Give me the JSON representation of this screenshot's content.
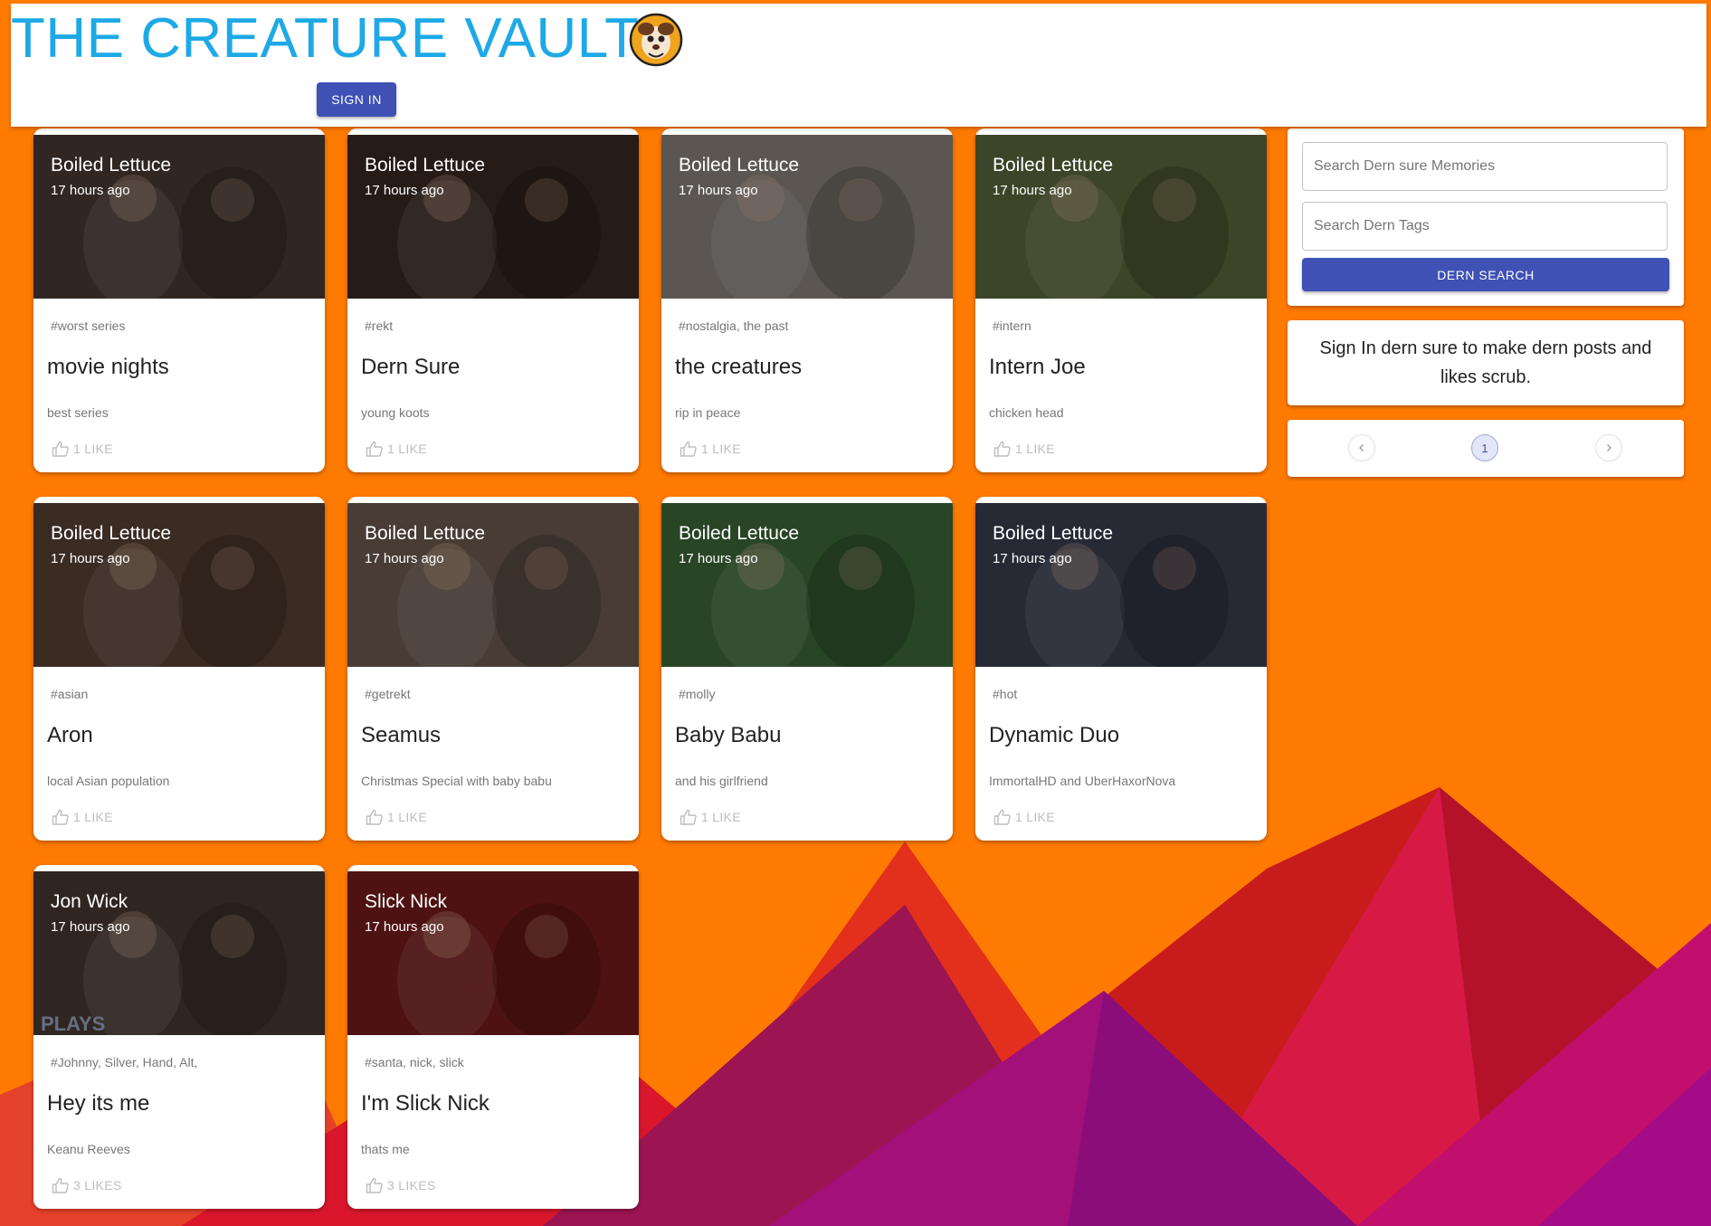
{
  "header": {
    "site_title": "THE CREATURE VAULT",
    "logo_icon": "creature-face-logo",
    "signin_label": "SIGN IN"
  },
  "posts": [
    {
      "author": "Boiled Lettuce",
      "time": "17 hours ago",
      "tags": "#worst series",
      "title": "movie nights",
      "description": "best series",
      "likes": "1 LIKE",
      "thumb_color": "#4a3c36"
    },
    {
      "author": "Boiled Lettuce",
      "time": "17 hours ago",
      "tags": "#rekt",
      "title": "Dern Sure",
      "description": "young koots",
      "likes": "1 LIKE",
      "thumb_color": "#3a2a24"
    },
    {
      "author": "Boiled Lettuce",
      "time": "17 hours ago",
      "tags": "#nostalgia, the past",
      "title": "the creatures",
      "description": "rip in peace",
      "likes": "1 LIKE",
      "thumb_color": "#8c857f"
    },
    {
      "author": "Boiled Lettuce",
      "time": "17 hours ago",
      "tags": "#intern",
      "title": "Intern Joe",
      "description": "chicken head",
      "likes": "1 LIKE",
      "thumb_color": "#5d6a3c"
    },
    {
      "author": "Boiled Lettuce",
      "time": "17 hours ago",
      "tags": "#asian",
      "title": "Aron",
      "description": "local Asian population",
      "likes": "1 LIKE",
      "thumb_color": "#5a4236"
    },
    {
      "author": "Boiled Lettuce",
      "time": "17 hours ago",
      "tags": "#getrekt",
      "title": "Seamus",
      "description": "Christmas Special with baby babu",
      "likes": "1 LIKE",
      "thumb_color": "#6f5d52"
    },
    {
      "author": "Boiled Lettuce",
      "time": "17 hours ago",
      "tags": "#molly",
      "title": "Baby Babu",
      "description": "and his girlfriend",
      "likes": "1 LIKE",
      "thumb_color": "#3e6b3a"
    },
    {
      "author": "Boiled Lettuce",
      "time": "17 hours ago",
      "tags": "#hot",
      "title": "Dynamic Duo",
      "description": "ImmortalHD and UberHaxorNova",
      "likes": "1 LIKE",
      "thumb_color": "#3c3f52"
    },
    {
      "author": "Jon Wick",
      "time": "17 hours ago",
      "tags": "#Johnny, Silver, Hand, Alt,",
      "title": "Hey its me",
      "description": "Keanu Reeves",
      "likes": "3 LIKES",
      "thumb_color": "#4a3b34",
      "watermark": "PLAYS"
    },
    {
      "author": "Slick Nick",
      "time": "17 hours ago",
      "tags": "#santa, nick, slick",
      "title": "I'm Slick Nick",
      "description": "thats me",
      "likes": "3 LIKES",
      "thumb_color": "#7a1c1c"
    }
  ],
  "sidebar": {
    "search_memories_placeholder": "Search Dern sure Memories",
    "search_tags_placeholder": "Search Dern Tags",
    "search_button_label": "DERN SEARCH",
    "signin_message": "Sign In dern sure to make dern posts and likes scrub.",
    "pagination": {
      "prev_icon": "chevron-left-icon",
      "current_page": "1",
      "next_icon": "chevron-right-icon"
    }
  },
  "colors": {
    "background": "#ff7a00",
    "title_blue": "#1ea9e6",
    "primary_button": "#3f51b5"
  }
}
